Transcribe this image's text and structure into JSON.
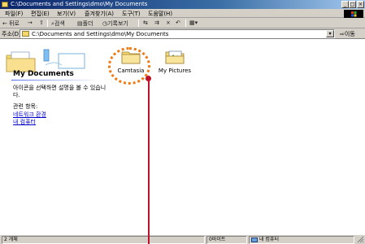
{
  "window": {
    "title": "C:\\Documents and Settings\\dmo\\My Documents",
    "buttons": [
      "_",
      "□",
      "×"
    ]
  },
  "menu": [
    "파일(F)",
    "편집(E)",
    "보기(V)",
    "즐겨찾기(A)",
    "도구(T)",
    "도움말(H)"
  ],
  "toolbar": {
    "back": "← 뒤로",
    "forward": "→",
    "up": "⇧",
    "search": "검색",
    "folders": "폴더",
    "history": "기록보기",
    "move": "⇆",
    "copy": "⇉",
    "delete": "×",
    "undo": "↶",
    "views": "▦▾"
  },
  "address": {
    "label": "주소(D)",
    "value": "C:\\Documents and Settings\\dmo\\My Documents",
    "dropdown": "▾",
    "go": "이동"
  },
  "panel": {
    "title": "My Documents",
    "description": "아이콘을 선택하면 설명을 볼 수 있습니다.",
    "links_heading": "관련 항목:",
    "links": [
      "네트워크 환경",
      "내 컴퓨터"
    ]
  },
  "folders": [
    {
      "name": "Camtasia",
      "icon": "folder-icon"
    },
    {
      "name": "My Pictures",
      "icon": "pictures-folder-icon"
    }
  ],
  "status": {
    "count": "2 개체",
    "size": "0바이트",
    "location": "내 컴퓨터"
  },
  "colors": {
    "titlebar_start": "#0a246a",
    "titlebar_end": "#a6caf0",
    "highlight": "#f07a10",
    "pointer": "#c0102a",
    "link": "#0000cc"
  }
}
